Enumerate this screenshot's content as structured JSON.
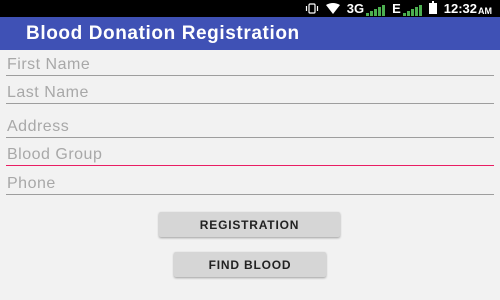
{
  "status_bar": {
    "network": "3G",
    "network2": "E",
    "time": "12:32",
    "ampm": "AM"
  },
  "app_bar": {
    "title": "Blood Donation Registration"
  },
  "form": {
    "first_name": {
      "value": "",
      "placeholder": "First Name"
    },
    "last_name": {
      "value": "",
      "placeholder": "Last Name"
    },
    "address": {
      "value": "",
      "placeholder": "Address"
    },
    "blood_group": {
      "value": "",
      "placeholder": "Blood Group"
    },
    "phone": {
      "value": "",
      "placeholder": "Phone"
    }
  },
  "buttons": {
    "registration": "REGISTRATION",
    "find_blood": "FIND BLOOD"
  },
  "colors": {
    "app_bar": "#3f51b5",
    "focus_underline": "#e91e63",
    "signal": "#4caf50"
  }
}
